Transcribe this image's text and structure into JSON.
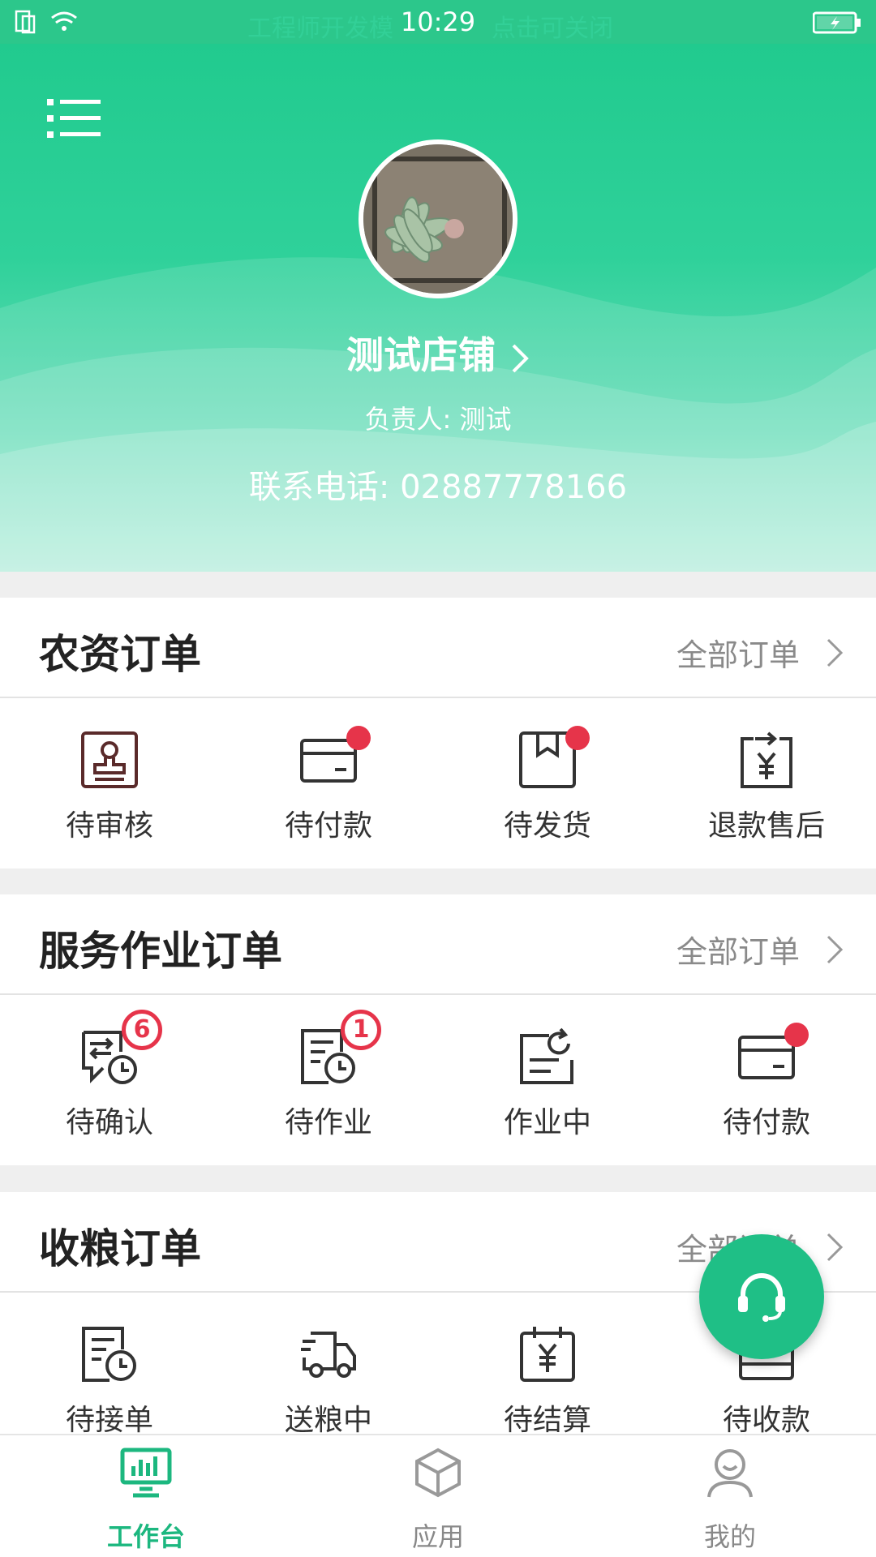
{
  "status_bar": {
    "time": "10:29",
    "ghost_left": "工程师开发模",
    "ghost_right": "点击可关闭"
  },
  "header": {
    "shop_name": "测试店铺",
    "owner": "负责人: 测试",
    "phone": "联系电话: 02887778166",
    "accent": "#1ec98c"
  },
  "sections": {
    "agri": {
      "title": "农资订单",
      "all_label": "全部订单",
      "items": [
        {
          "label": "待审核",
          "icon": "stamp-icon"
        },
        {
          "label": "待付款",
          "icon": "card-icon",
          "dot": true
        },
        {
          "label": "待发货",
          "icon": "box-icon",
          "dot": true
        },
        {
          "label": "退款售后",
          "icon": "refund-icon"
        }
      ]
    },
    "service": {
      "title": "服务作业订单",
      "all_label": "全部订单",
      "items": [
        {
          "label": "待确认",
          "icon": "confirm-clock-icon",
          "badge": "6"
        },
        {
          "label": "待作业",
          "icon": "doc-clock-icon",
          "badge": "1"
        },
        {
          "label": "作业中",
          "icon": "doc-refresh-icon"
        },
        {
          "label": "待付款",
          "icon": "card-icon",
          "dot": true
        }
      ]
    },
    "grain": {
      "title": "收粮订单",
      "all_label": "全部订单",
      "items": [
        {
          "label": "待接单",
          "icon": "doc-clock-icon"
        },
        {
          "label": "送粮中",
          "icon": "truck-icon"
        },
        {
          "label": "待结算",
          "icon": "calendar-yen-icon"
        },
        {
          "label": "待收款",
          "icon": "wallet-icon"
        }
      ]
    }
  },
  "tabbar": {
    "tabs": [
      {
        "label": "工作台",
        "icon": "dashboard-icon",
        "active": true
      },
      {
        "label": "应用",
        "icon": "cube-icon"
      },
      {
        "label": "我的",
        "icon": "user-icon"
      }
    ],
    "active_color": "#1cb77f"
  }
}
